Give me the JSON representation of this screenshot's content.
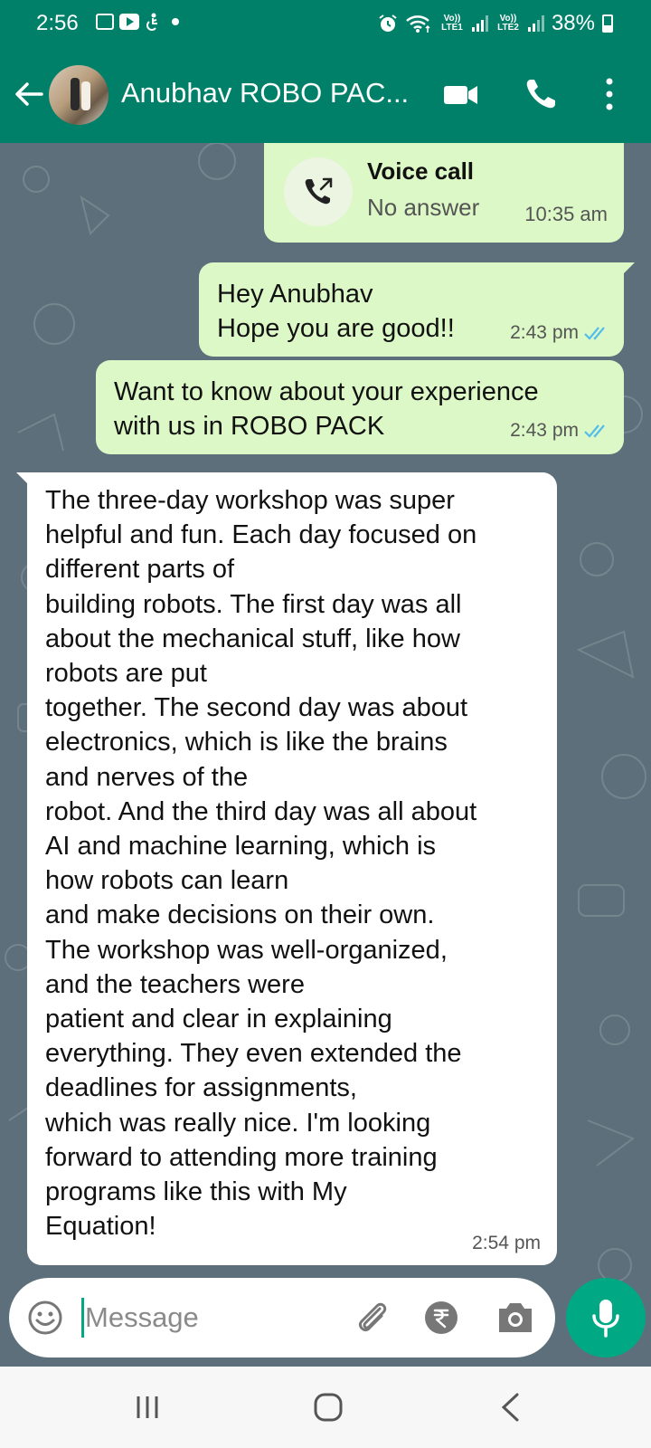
{
  "status_bar": {
    "time": "2:56",
    "battery": "38%",
    "sim1": "Vo)) LTE1",
    "sim2": "Vo)) LTE2"
  },
  "header": {
    "contact_name": "Anubhav ROBO PAC..."
  },
  "messages": [
    {
      "type": "call",
      "direction": "outgoing",
      "title": "Voice call",
      "status": "No answer",
      "time": "10:35 am"
    },
    {
      "type": "text",
      "direction": "outgoing",
      "text": "Hey Anubhav\nHope you are good!!",
      "time": "2:43 pm",
      "read": true
    },
    {
      "type": "text",
      "direction": "outgoing",
      "text": "Want to know about your experience\nwith us in ROBO PACK",
      "time": "2:43 pm",
      "read": true
    },
    {
      "type": "text",
      "direction": "incoming",
      "text": "The three-day workshop was super\nhelpful and fun. Each day focused on\ndifferent parts of\nbuilding robots. The first day was all\nabout the mechanical stuff, like how\nrobots are put\ntogether. The second day was about\nelectronics, which is like the brains\nand nerves of the\nrobot. And the third day was all about\nAI and machine learning, which is\nhow robots can learn\nand make decisions on their own.\nThe workshop was well-organized,\nand the teachers were\npatient and clear in explaining\neverything. They even extended the\ndeadlines for assignments,\nwhich was really nice. I'm looking\nforward to attending more training\nprograms like this with My\nEquation!",
      "time": "2:54 pm"
    }
  ],
  "composer": {
    "placeholder": "Message",
    "value": ""
  },
  "colors": {
    "header": "#008069",
    "outgoing_bubble": "#dcf8c6",
    "incoming_bubble": "#ffffff",
    "accent": "#00a884",
    "read_tick": "#53bdeb"
  },
  "icons": [
    "back-arrow-icon",
    "video-call-icon",
    "phone-icon",
    "more-options-icon",
    "outgoing-call-icon",
    "double-tick-icon",
    "emoji-icon",
    "attach-icon",
    "rupee-icon",
    "camera-icon",
    "mic-icon",
    "nav-recents-icon",
    "nav-home-icon",
    "nav-back-icon"
  ]
}
